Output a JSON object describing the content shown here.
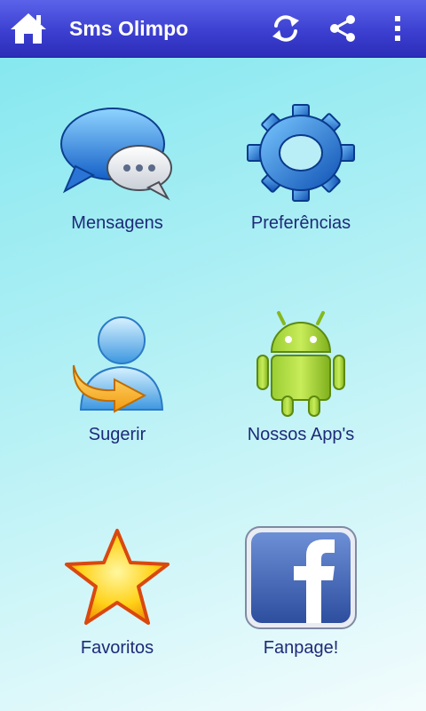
{
  "actionbar": {
    "title": "Sms Olimpo",
    "icons": [
      "home-icon",
      "refresh-icon",
      "share-icon",
      "overflow-menu-icon"
    ],
    "color": "#3c3fd0"
  },
  "grid": {
    "items": [
      {
        "label": "Mensagens",
        "icon": "chat-bubbles-icon"
      },
      {
        "label": "Preferências",
        "icon": "gear-icon"
      },
      {
        "label": "Sugerir",
        "icon": "user-arrow-icon"
      },
      {
        "label": "Nossos App's",
        "icon": "android-icon"
      },
      {
        "label": "Favoritos",
        "icon": "star-icon"
      },
      {
        "label": "Fanpage!",
        "icon": "facebook-icon"
      }
    ]
  },
  "colors": {
    "label_text": "#1e2a78",
    "background_top": "#7fe6ef",
    "background_bottom": "#f3fcfd"
  }
}
